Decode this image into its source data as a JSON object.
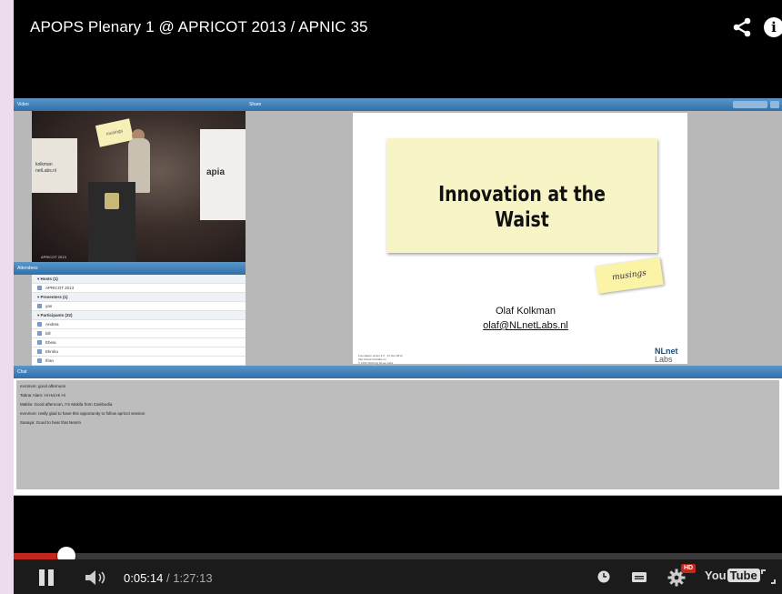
{
  "video": {
    "title": "APOPS Plenary 1 @ APRICOT 2013 / APNIC 35",
    "progress_fraction": 0.0686
  },
  "meeting": {
    "video_panel_title": "Video",
    "share_panel_title": "Share",
    "attendees_panel_title": "Attendees",
    "chat_panel_title": "Chat",
    "attendee_rows": [
      {
        "label": "Hosts (1)",
        "group": true
      },
      {
        "label": "APRICOT 2013",
        "group": false
      },
      {
        "label": "Presenters (1)",
        "group": true
      },
      {
        "label": "yan",
        "group": false
      },
      {
        "label": "Participants (32)",
        "group": true
      },
      {
        "label": "Andrea",
        "group": false
      },
      {
        "label": "bill",
        "group": false
      },
      {
        "label": "Ebeia",
        "group": false
      },
      {
        "label": "Ekroku",
        "group": false
      },
      {
        "label": "Ifran",
        "group": false
      }
    ],
    "chat_lines": [
      "evromon: good afternoon",
      "Tabrar Alam: Hi Hai Hi Hi",
      "Makila: Good afternoon, I'm Makila from Cambodia",
      "evromon: really glad to have this opportunity to follow apricot session",
      "Sanaya: Good to hear that Nesrin"
    ]
  },
  "slide": {
    "title_line1": "Innovation at the",
    "title_line2": "Waist",
    "sticky_note": "musings",
    "author": "Olaf Kolkman",
    "email": "olaf@NLnetLabs.nl",
    "logo_top": "NLnet",
    "logo_bottom": "Labs"
  },
  "controls": {
    "current_time": "0:05:14",
    "separator": " / ",
    "duration": "1:27:13",
    "hd_badge": "HD",
    "logo_you": "You",
    "logo_tube": "Tube"
  },
  "colors": {
    "progress_played": "#c3281e",
    "panel_header": "#2f6fa8"
  }
}
